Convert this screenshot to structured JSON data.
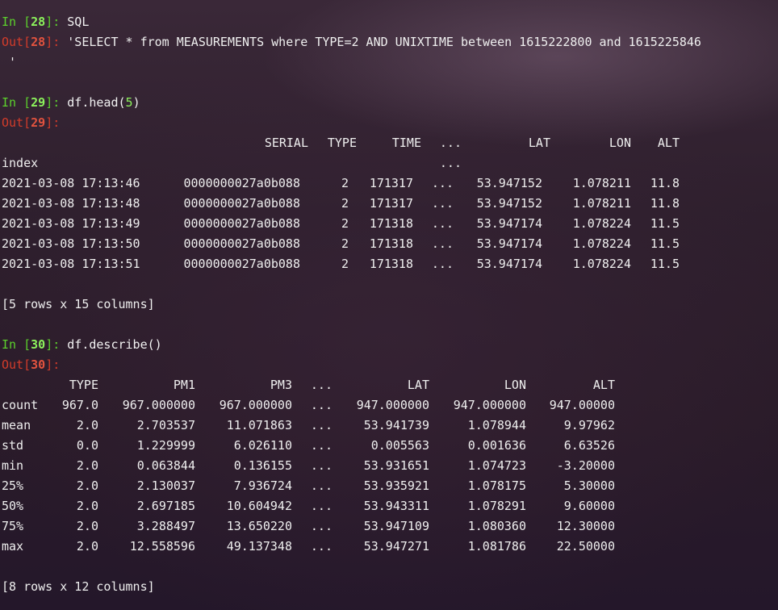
{
  "terminal": {
    "cells": [
      {
        "in_label": "In",
        "in_num": "28",
        "code": "SQL",
        "out_label": "Out",
        "out_num": "28",
        "output_lines": [
          "'SELECT * from MEASUREMENTS where TYPE=2 AND UNIXTIME between 1615222800 and 1615225846",
          " '"
        ]
      },
      {
        "in_label": "In",
        "in_num": "29",
        "code_prefix": "df.head(",
        "code_arg": "5",
        "code_suffix": ")",
        "out_label": "Out",
        "out_num": "29",
        "table": {
          "header": [
            "SERIAL",
            "TYPE",
            "TIME",
            "...",
            "LAT",
            "LON",
            "ALT"
          ],
          "index_name": "index",
          "index_ellipsis": "...",
          "rows": [
            [
              "2021-03-08 17:13:46",
              "0000000027a0b088",
              "2",
              "171317",
              "...",
              "53.947152",
              "1.078211",
              "11.8"
            ],
            [
              "2021-03-08 17:13:48",
              "0000000027a0b088",
              "2",
              "171317",
              "...",
              "53.947152",
              "1.078211",
              "11.8"
            ],
            [
              "2021-03-08 17:13:49",
              "0000000027a0b088",
              "2",
              "171318",
              "...",
              "53.947174",
              "1.078224",
              "11.5"
            ],
            [
              "2021-03-08 17:13:50",
              "0000000027a0b088",
              "2",
              "171318",
              "...",
              "53.947174",
              "1.078224",
              "11.5"
            ],
            [
              "2021-03-08 17:13:51",
              "0000000027a0b088",
              "2",
              "171318",
              "...",
              "53.947174",
              "1.078224",
              "11.5"
            ]
          ],
          "shape": "[5 rows x 15 columns]"
        }
      },
      {
        "in_label": "In",
        "in_num": "30",
        "code": "df.describe()",
        "out_label": "Out",
        "out_num": "30",
        "table": {
          "header": [
            "TYPE",
            "PM1",
            "PM3",
            "...",
            "LAT",
            "LON",
            "ALT"
          ],
          "rows": [
            [
              "count",
              "967.0",
              "967.000000",
              "967.000000",
              "...",
              "947.000000",
              "947.000000",
              "947.00000"
            ],
            [
              "mean",
              "2.0",
              "2.703537",
              "11.071863",
              "...",
              "53.941739",
              "1.078944",
              "9.97962"
            ],
            [
              "std",
              "0.0",
              "1.229999",
              "6.026110",
              "...",
              "0.005563",
              "0.001636",
              "6.63526"
            ],
            [
              "min",
              "2.0",
              "0.063844",
              "0.136155",
              "...",
              "53.931651",
              "1.074723",
              "-3.20000"
            ],
            [
              "25%",
              "2.0",
              "2.130037",
              "7.936724",
              "...",
              "53.935921",
              "1.078175",
              "5.30000"
            ],
            [
              "50%",
              "2.0",
              "2.697185",
              "10.604942",
              "...",
              "53.943311",
              "1.078291",
              "9.60000"
            ],
            [
              "75%",
              "2.0",
              "3.288497",
              "13.650220",
              "...",
              "53.947109",
              "1.080360",
              "12.30000"
            ],
            [
              "max",
              "2.0",
              "12.558596",
              "49.137348",
              "...",
              "53.947271",
              "1.081786",
              "22.50000"
            ]
          ],
          "shape": "[8 rows x 12 columns]"
        }
      }
    ]
  },
  "colors": {
    "in_prompt": "#5cd12c",
    "out_prompt": "#d33c2a",
    "text": "#efefef"
  }
}
